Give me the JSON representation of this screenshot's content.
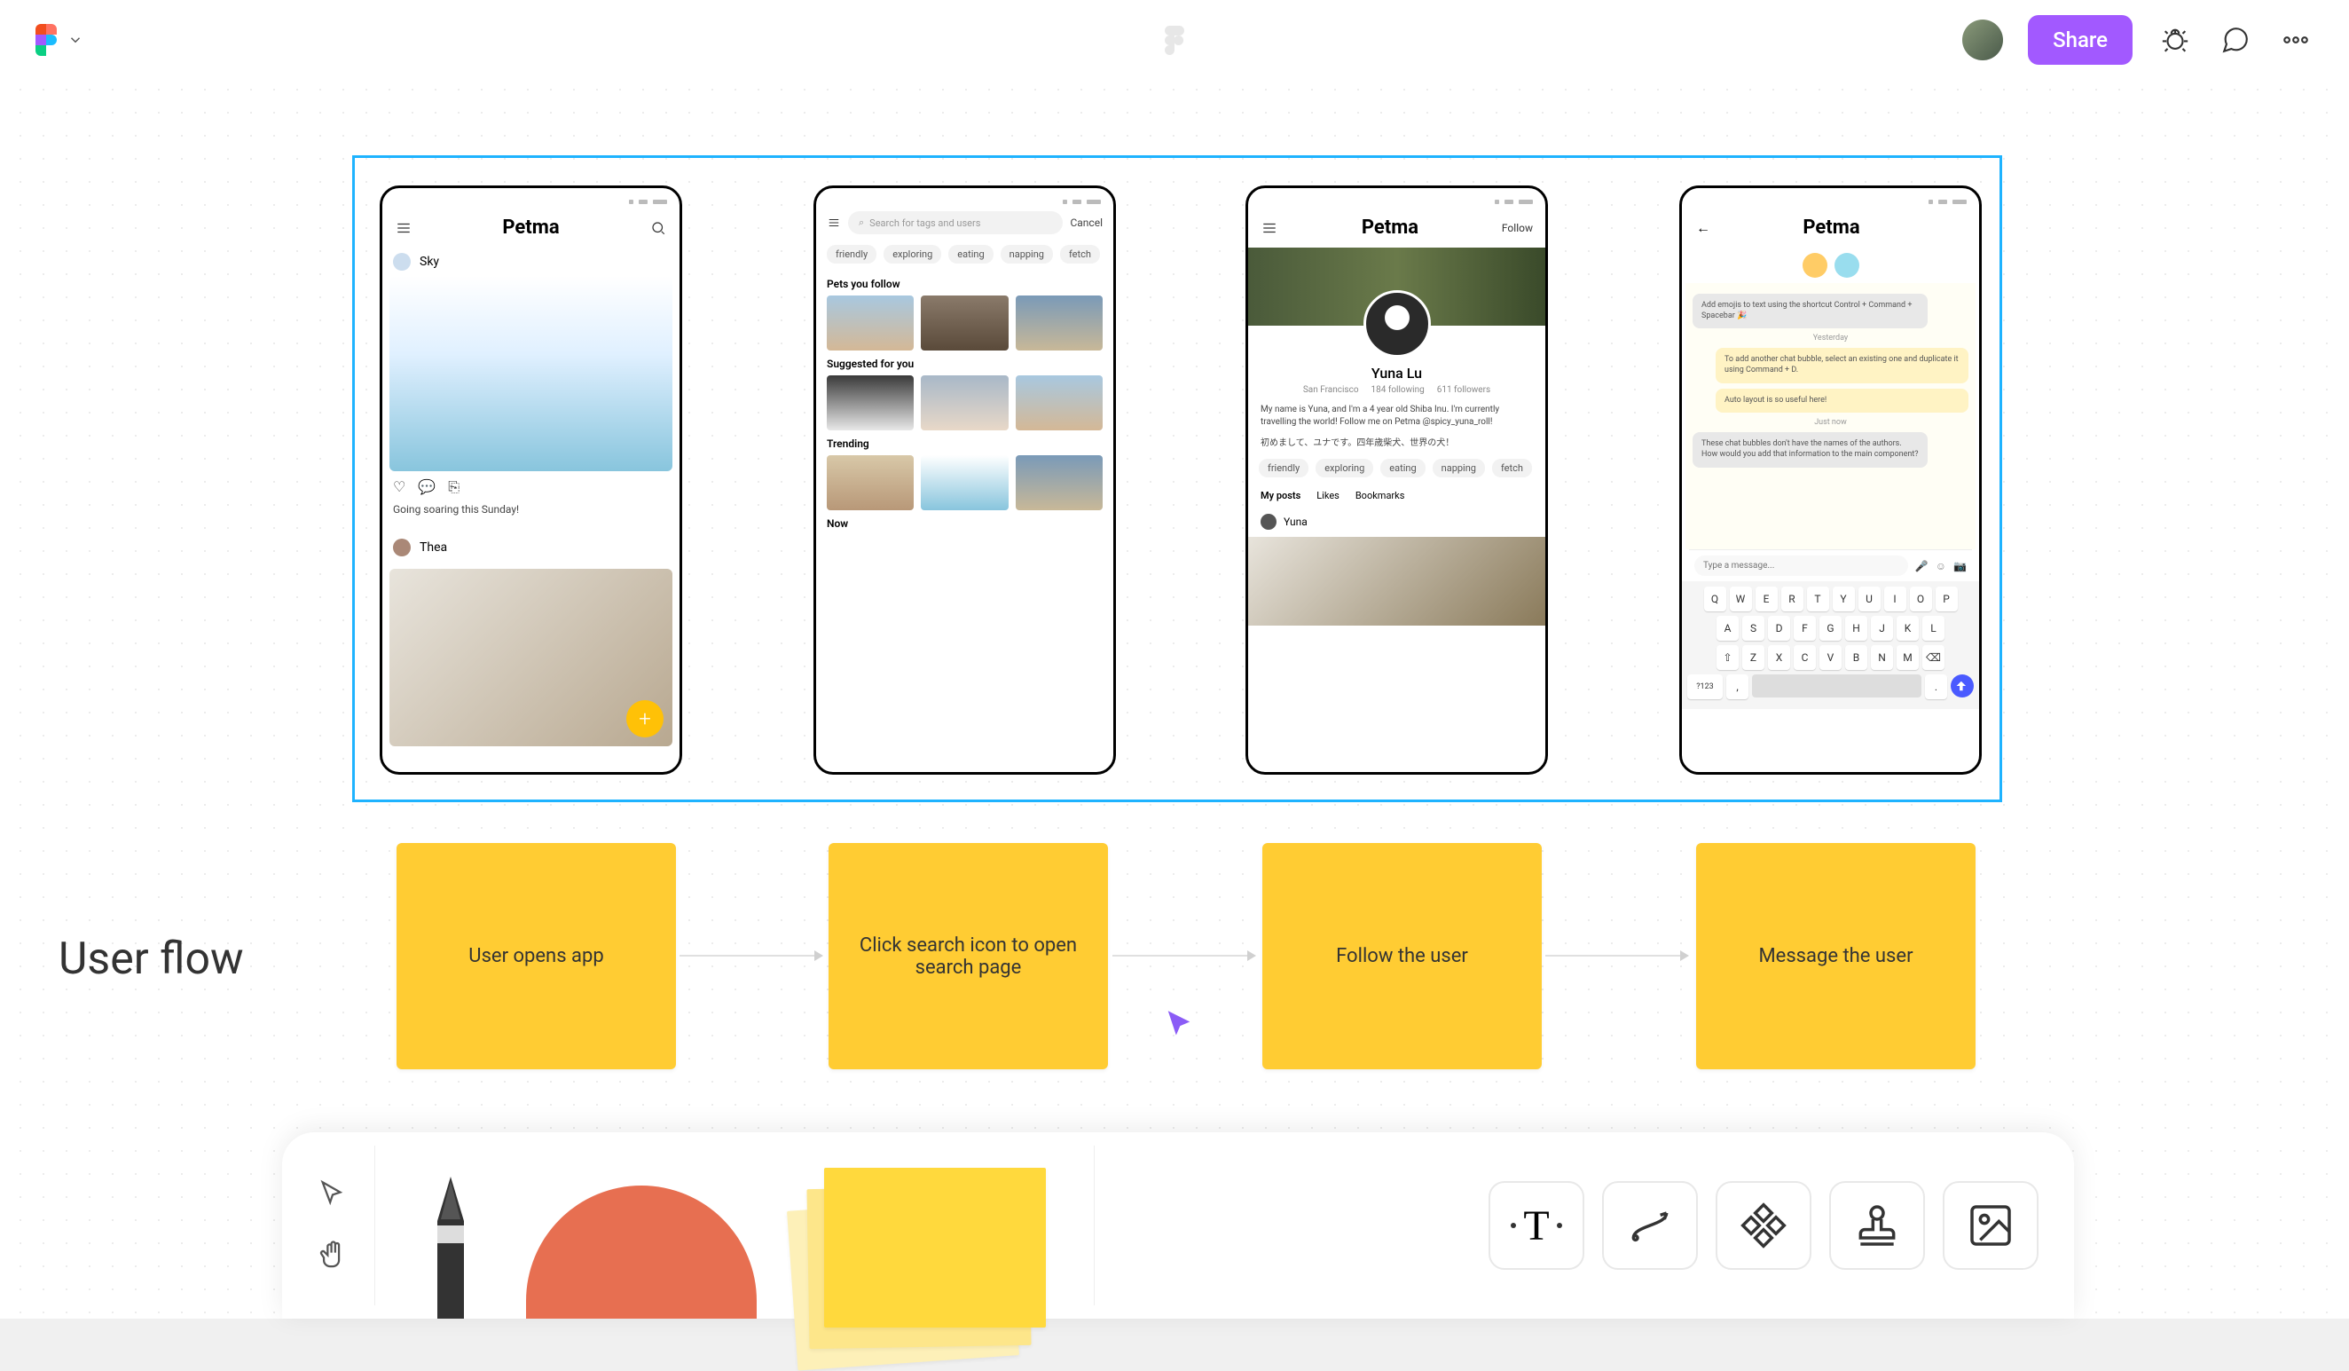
{
  "topbar": {
    "share_label": "Share"
  },
  "app_title": "Petma",
  "flow_label": "User flow",
  "stickies": [
    "User opens app",
    "Click search icon to open search page",
    "Follow the user",
    "Message the user"
  ],
  "feed": {
    "user1": "Sky",
    "caption": "Going soaring this Sunday!",
    "user2": "Thea"
  },
  "search": {
    "placeholder": "Search for tags and users",
    "cancel": "Cancel",
    "tags": [
      "friendly",
      "exploring",
      "eating",
      "napping",
      "fetch"
    ],
    "sec1": "Pets you follow",
    "sec2": "Suggested for you",
    "sec3": "Trending",
    "sec4": "Now"
  },
  "profile": {
    "follow": "Follow",
    "name": "Yuna Lu",
    "loc": "San Francisco",
    "following": "184 following",
    "followers": "611 followers",
    "bio1": "My name is Yuna, and I'm a 4 year old Shiba Inu. I'm currently travelling the world! Follow me on Petma @spicy_yuna_roll!",
    "bio2": "初めまして、ユナです。四年歳柴犬、世界の犬！",
    "tags": [
      "friendly",
      "exploring",
      "eating",
      "napping",
      "fetch"
    ],
    "tabs": [
      "My posts",
      "Likes",
      "Bookmarks"
    ],
    "post_user": "Yuna"
  },
  "chat": {
    "msg1": "Add emojis to text using the shortcut Control + Command + Spacebar 🎉",
    "time1": "Yesterday",
    "msg2": "To add another chat bubble, select an existing one and duplicate it using Command + D.",
    "msg3": "Auto layout is so useful here!",
    "time2": "Just now",
    "msg4": "These chat bubbles don't have the names of the authors. How would you add that information to the main component?",
    "input_placeholder": "Type a message...",
    "keys_r1": [
      "Q",
      "W",
      "E",
      "R",
      "T",
      "Y",
      "U",
      "I",
      "O",
      "P"
    ],
    "keys_r2": [
      "A",
      "S",
      "D",
      "F",
      "G",
      "H",
      "J",
      "K",
      "L"
    ],
    "keys_r3": [
      "Z",
      "X",
      "C",
      "V",
      "B",
      "N",
      "M"
    ],
    "key_123": "?123"
  }
}
